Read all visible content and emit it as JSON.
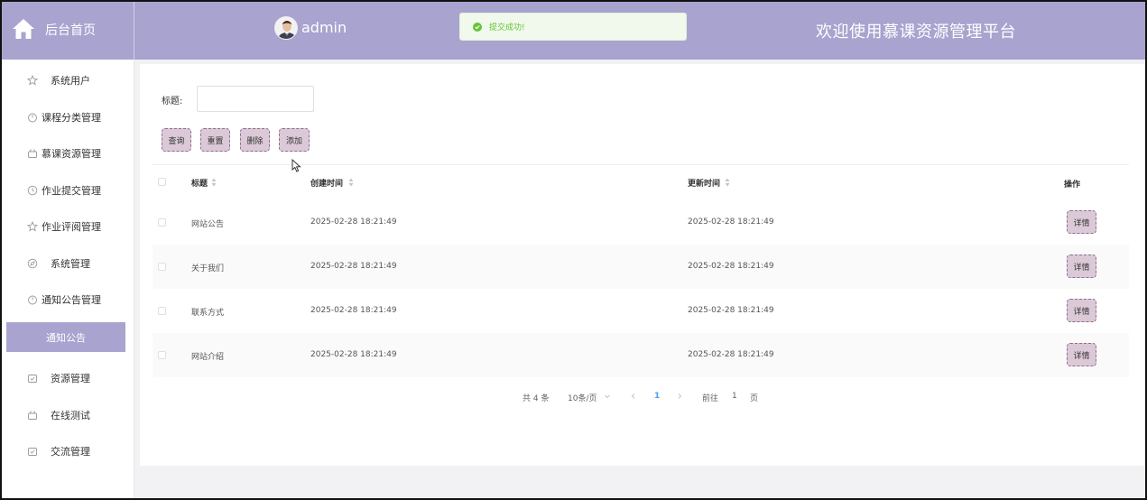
{
  "header": {
    "home_label": "后台首页",
    "admin_name": "admin",
    "welcome": "欢迎使用慕课资源管理平台"
  },
  "toast": {
    "message": "提交成功!"
  },
  "sidebar": {
    "items": [
      {
        "label": "系统用户",
        "icon": "star-icon"
      },
      {
        "label": "课程分类管理",
        "icon": "timer-icon"
      },
      {
        "label": "慕课资源管理",
        "icon": "basket-icon"
      },
      {
        "label": "作业提交管理",
        "icon": "clock-icon"
      },
      {
        "label": "作业评阅管理",
        "icon": "star-icon"
      },
      {
        "label": "系统管理",
        "icon": "compass-icon"
      },
      {
        "label": "通知公告管理",
        "icon": "timer-icon"
      },
      {
        "label": "资源管理",
        "icon": "calendar-icon"
      },
      {
        "label": "在线测试",
        "icon": "basket-icon"
      },
      {
        "label": "交流管理",
        "icon": "calendar-icon"
      }
    ],
    "active_sub": "通知公告"
  },
  "search": {
    "label": "标题:",
    "value": "",
    "placeholder": ""
  },
  "buttons": {
    "query": "查询",
    "reset": "重置",
    "delete": "删除",
    "add": "添加"
  },
  "table": {
    "columns": {
      "title": "标题",
      "created": "创建时间",
      "updated": "更新时间",
      "actions": "操作"
    },
    "rows": [
      {
        "title": "网站公告",
        "created": "2025-02-28 18:21:49",
        "updated": "2025-02-28 18:21:49",
        "action": "详情"
      },
      {
        "title": "关于我们",
        "created": "2025-02-28 18:21:49",
        "updated": "2025-02-28 18:21:49",
        "action": "详情"
      },
      {
        "title": "联系方式",
        "created": "2025-02-28 18:21:49",
        "updated": "2025-02-28 18:21:49",
        "action": "详情"
      },
      {
        "title": "网站介绍",
        "created": "2025-02-28 18:21:49",
        "updated": "2025-02-28 18:21:49",
        "action": "详情"
      }
    ]
  },
  "pagination": {
    "total": "共 4 条",
    "page_size": "10条/页",
    "current": "1",
    "goto_label": "前往",
    "goto_value": "1",
    "page_suffix": "页"
  },
  "colors": {
    "header": "#a9a3cf",
    "button": "#dcc9d7",
    "success": "#67c23a",
    "pager_active": "#409eff"
  }
}
